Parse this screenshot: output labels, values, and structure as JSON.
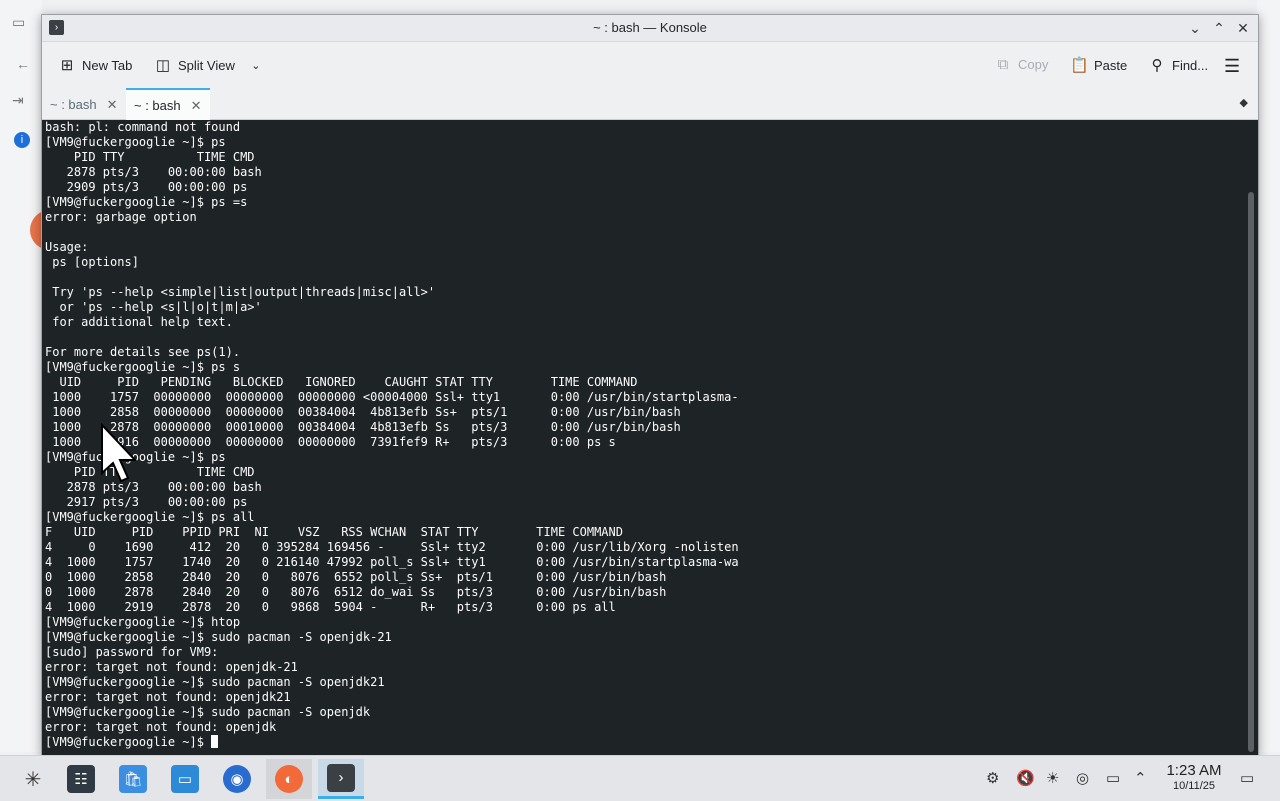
{
  "window": {
    "title": "~ : bash — Konsole"
  },
  "toolbar": {
    "new_tab": "New Tab",
    "split_view": "Split View",
    "copy": "Copy",
    "paste": "Paste",
    "find": "Find..."
  },
  "tabs": [
    {
      "label": "~ : bash",
      "active": false
    },
    {
      "label": "~ : bash",
      "active": true
    }
  ],
  "terminal_lines": [
    "bash: pl: command not found",
    "[VM9@fuckergooglie ~]$ ps",
    "    PID TTY          TIME CMD",
    "   2878 pts/3    00:00:00 bash",
    "   2909 pts/3    00:00:00 ps",
    "[VM9@fuckergooglie ~]$ ps =s",
    "error: garbage option",
    "",
    "Usage:",
    " ps [options]",
    "",
    " Try 'ps --help <simple|list|output|threads|misc|all>'",
    "  or 'ps --help <s|l|o|t|m|a>'",
    " for additional help text.",
    "",
    "For more details see ps(1).",
    "[VM9@fuckergooglie ~]$ ps s",
    "  UID     PID   PENDING   BLOCKED   IGNORED    CAUGHT STAT TTY        TIME COMMAND",
    " 1000    1757  00000000  00000000  00000000 <00004000 Ssl+ tty1       0:00 /usr/bin/startplasma-",
    " 1000    2858  00000000  00000000  00384004  4b813efb Ss+  pts/1      0:00 /usr/bin/bash",
    " 1000    2878  00000000  00010000  00384004  4b813efb Ss   pts/3      0:00 /usr/bin/bash",
    " 1000    2916  00000000  00000000  00000000  7391fef9 R+   pts/3      0:00 ps s",
    "[VM9@fuckergooglie ~]$ ps",
    "    PID TTY          TIME CMD",
    "   2878 pts/3    00:00:00 bash",
    "   2917 pts/3    00:00:00 ps",
    "[VM9@fuckergooglie ~]$ ps all",
    "F   UID     PID    PPID PRI  NI    VSZ   RSS WCHAN  STAT TTY        TIME COMMAND",
    "4     0    1690     412  20   0 395284 169456 -     Ssl+ tty2       0:00 /usr/lib/Xorg -nolisten",
    "4  1000    1757    1740  20   0 216140 47992 poll_s Ssl+ tty1       0:00 /usr/bin/startplasma-wa",
    "0  1000    2858    2840  20   0   8076  6552 poll_s Ss+  pts/1      0:00 /usr/bin/bash",
    "0  1000    2878    2840  20   0   8076  6512 do_wai Ss   pts/3      0:00 /usr/bin/bash",
    "4  1000    2919    2878  20   0   9868  5904 -      R+   pts/3      0:00 ps all",
    "[VM9@fuckergooglie ~]$ htop",
    "[VM9@fuckergooglie ~]$ sudo pacman -S openjdk-21",
    "[sudo] password for VM9:",
    "error: target not found: openjdk-21",
    "[VM9@fuckergooglie ~]$ sudo pacman -S openjdk21",
    "error: target not found: openjdk21",
    "[VM9@fuckergooglie ~]$ sudo pacman -S openjdk",
    "error: target not found: openjdk"
  ],
  "prompt": "[VM9@fuckergooglie ~]$ ",
  "taskbar": {
    "time": "1:23 AM",
    "date": "10/11/25"
  },
  "icons": {
    "app": "konsole-icon",
    "launcher": "plasma-launcher-icon"
  }
}
